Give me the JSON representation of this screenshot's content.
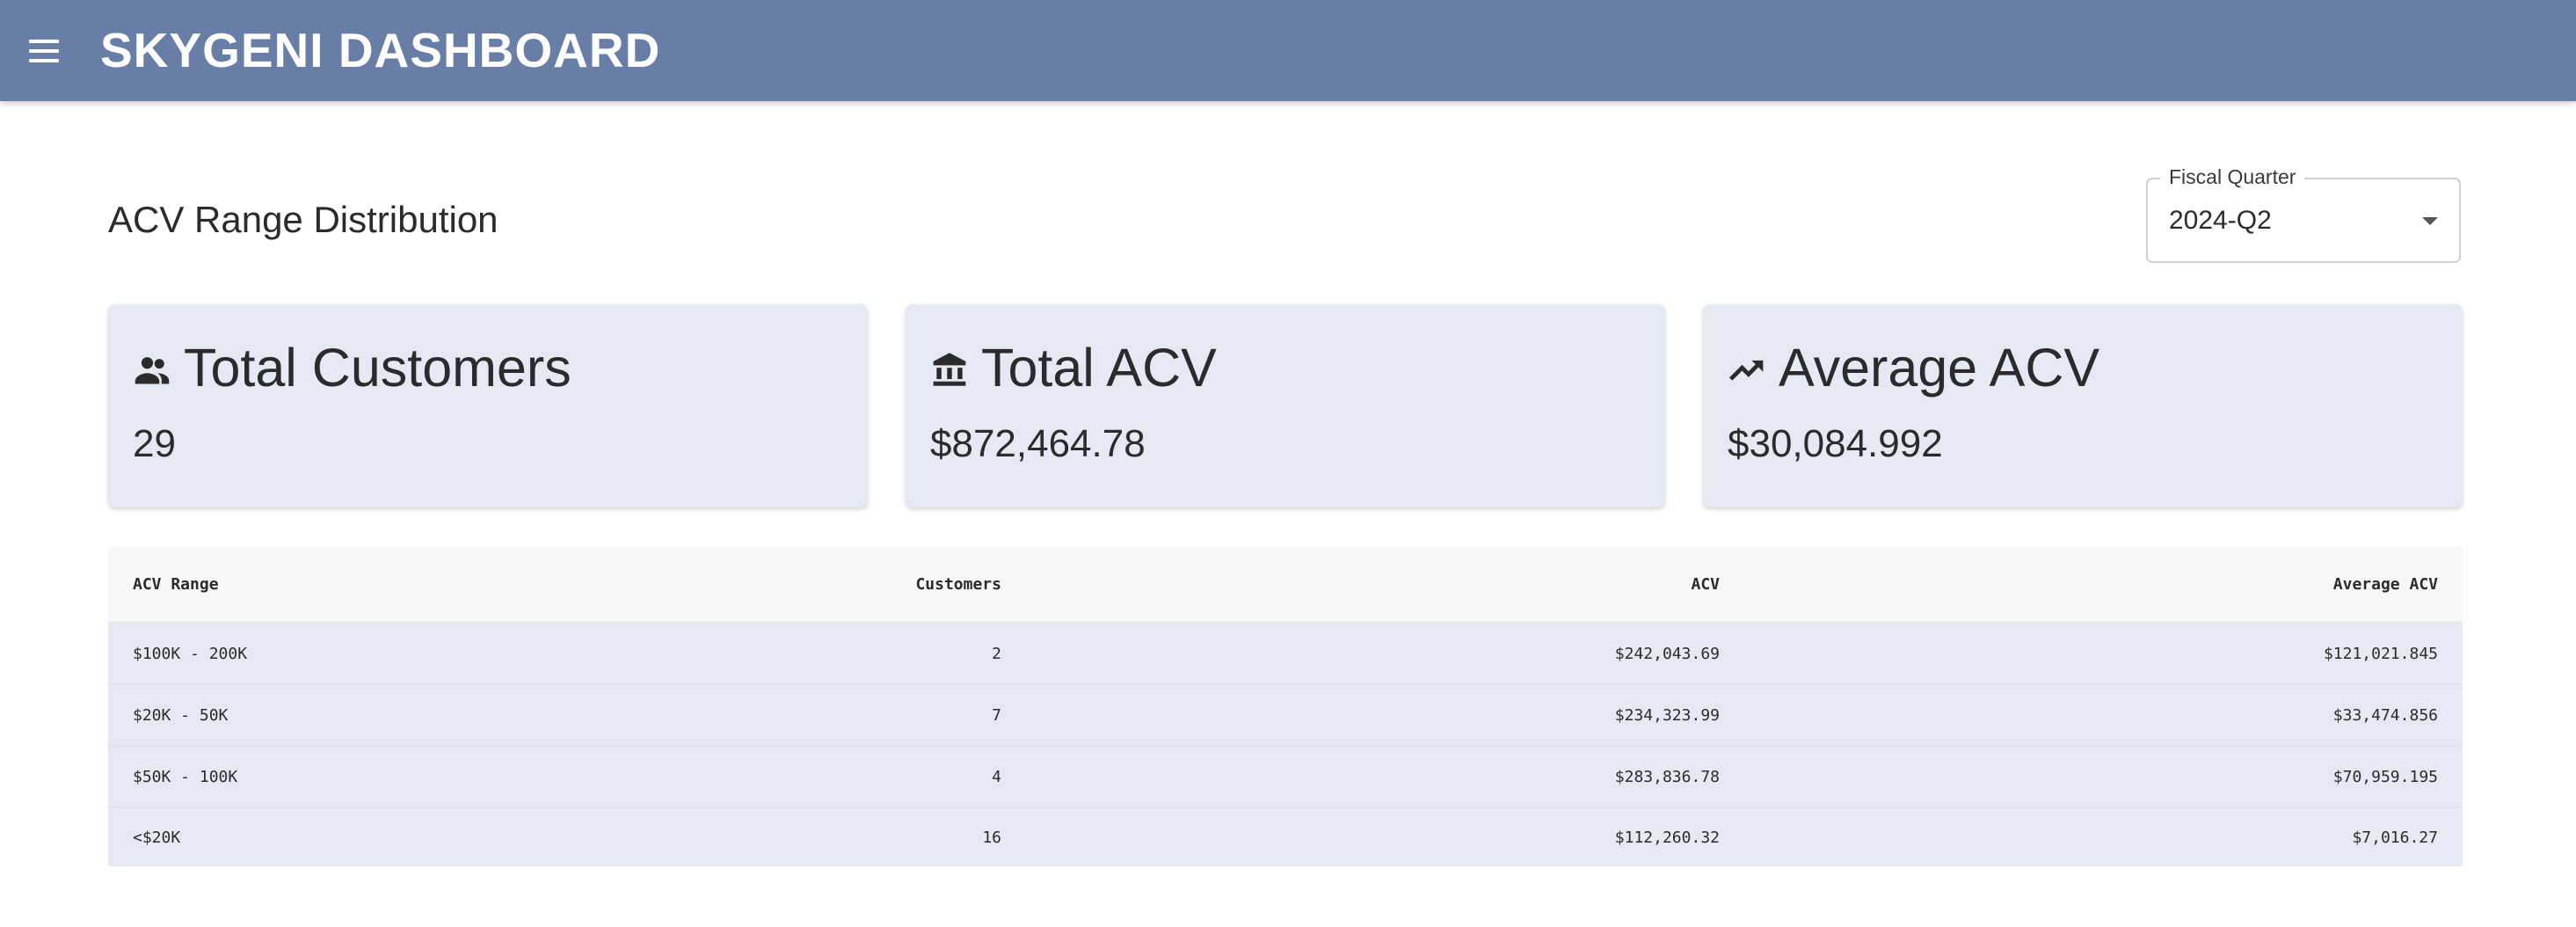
{
  "header": {
    "title": "SKYGENI DASHBOARD",
    "menu_icon": "hamburger-menu-icon",
    "background": "#687ea7"
  },
  "page": {
    "title": "ACV Range Distribution"
  },
  "filter": {
    "label": "Fiscal Quarter",
    "value": "2024-Q2",
    "arrow_icon": "dropdown-arrow-icon"
  },
  "cards": [
    {
      "icon": "people-icon",
      "title": "Total Customers",
      "value": "29"
    },
    {
      "icon": "bank-icon",
      "title": "Total ACV",
      "value": "$872,464.78"
    },
    {
      "icon": "trending-up-icon",
      "title": "Average ACV",
      "value": "$30,084.992"
    }
  ],
  "table": {
    "headers": [
      "ACV Range",
      "Customers",
      "ACV",
      "Average ACV"
    ],
    "rows": [
      [
        "$100K - 200K",
        "2",
        "$242,043.69",
        "$121,021.845"
      ],
      [
        "$20K - 50K",
        "7",
        "$234,323.99",
        "$33,474.856"
      ],
      [
        "$50K - 100K",
        "4",
        "$283,836.78",
        "$70,959.195"
      ],
      [
        "<$20K",
        "16",
        "$112,260.32",
        "$7,016.27"
      ]
    ]
  },
  "colors": {
    "card_background": "#e4e9f3",
    "table_header_background": "#f6f7f9"
  }
}
